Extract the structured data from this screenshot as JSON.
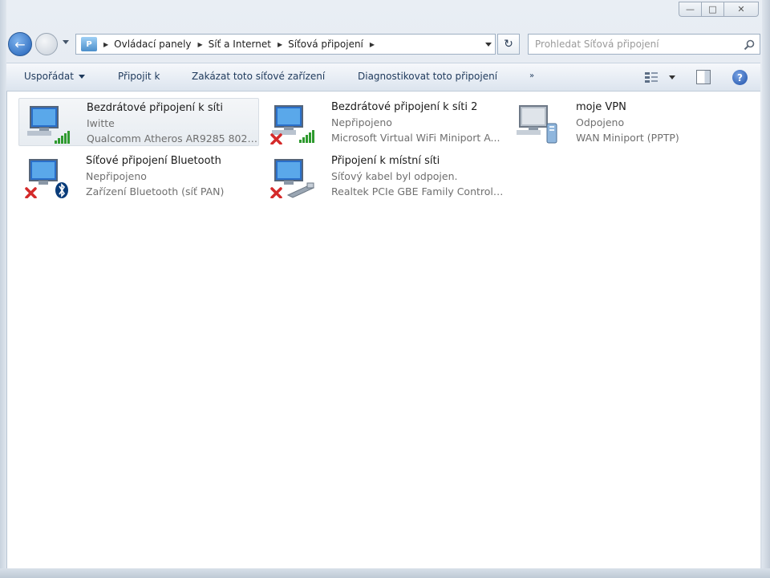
{
  "window": {
    "caption": {
      "minimize_glyph": "—",
      "maximize_glyph": "□",
      "close_glyph": "✕"
    }
  },
  "nav": {
    "back_glyph": "←",
    "breadcrumbs": [
      "Ovládací panely",
      "Síť a Internet",
      "Síťová připojení"
    ],
    "refresh_glyph": "↻",
    "search_placeholder": "Prohledat Síťová připojení"
  },
  "toolbar": {
    "organize_label": "Uspořádat",
    "connect_label": "Připojit k",
    "disable_label": "Zakázat toto síťové zařízení",
    "diagnose_label": "Diagnostikovat toto připojení",
    "more_glyph": "»",
    "help_glyph": "?"
  },
  "connections": [
    {
      "name": "Bezdrátové připojení k síti",
      "status": "Iwitte",
      "device": "Qualcomm Atheros AR9285 802.1...",
      "icon": "wifi-monitor-icon",
      "overlay": "signal-bars-icon",
      "disconnected": false,
      "selected": true
    },
    {
      "name": "Bezdrátové připojení k síti 2",
      "status": "Nepřipojeno",
      "device": "Microsoft Virtual WiFi Miniport A...",
      "icon": "wifi-monitor-icon",
      "overlay": "signal-bars-icon",
      "disconnected": true,
      "selected": false
    },
    {
      "name": "moje VPN",
      "status": "Odpojeno",
      "device": "WAN Miniport (PPTP)",
      "icon": "vpn-monitor-icon",
      "overlay": "vpn-server-icon",
      "disconnected": false,
      "selected": false
    },
    {
      "name": "Síťové připojení Bluetooth",
      "status": "Nepřipojeno",
      "device": "Zařízení Bluetooth (síť PAN)",
      "icon": "bluetooth-monitor-icon",
      "overlay": "bluetooth-icon",
      "disconnected": true,
      "selected": false
    },
    {
      "name": "Připojení k místní síti",
      "status": "Síťový kabel byl odpojen.",
      "device": "Realtek PCIe GBE Family Controller",
      "icon": "lan-monitor-icon",
      "overlay": "network-cable-icon",
      "disconnected": true,
      "selected": false
    }
  ],
  "colors": {
    "accent": "#1e395b",
    "signal": "#2f9a2f",
    "error": "#d42a2a",
    "bluetooth": "#0a3c7a"
  }
}
